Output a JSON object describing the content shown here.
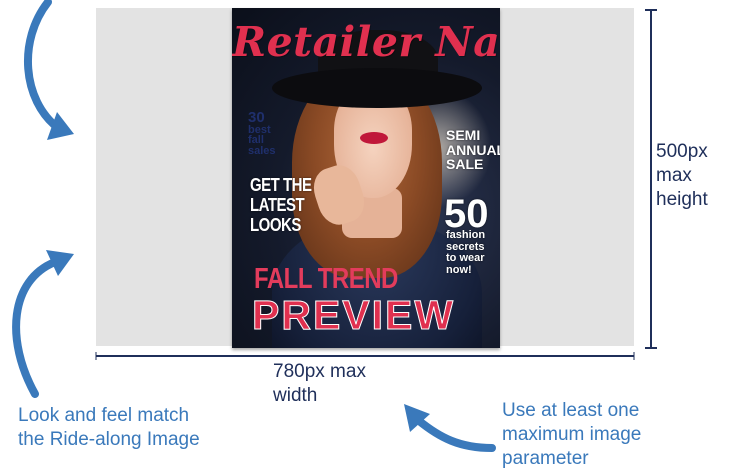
{
  "cover": {
    "masthead": "Retailer Name",
    "blurb_30_number": "30",
    "blurb_30_lines": [
      "best",
      "fall",
      "sales"
    ],
    "latest_lines": [
      "GET THE",
      "LATEST",
      "LOOKS"
    ],
    "semi_lines": [
      "SEMI",
      "ANNUAL",
      "SALE"
    ],
    "fifty_number": "50",
    "fifty_lines": [
      "fashion",
      "secrets",
      "to wear",
      "now!"
    ],
    "fall_trend": "FALL TREND",
    "preview": "PREVIEW"
  },
  "dimensions": {
    "height_lines": [
      "500px",
      "max",
      "height"
    ],
    "width_lines": [
      "780px max",
      "width"
    ]
  },
  "captions": {
    "left_lines": [
      "Look and feel match",
      "the Ride-along Image"
    ],
    "right_lines": [
      "Use at least one",
      "maximum image",
      "parameter"
    ]
  },
  "colors": {
    "arrow_blue": "#3a79bb",
    "dimension_navy": "#1f2f5a",
    "canvas_gray": "#e3e3e3",
    "masthead_red": "#e0304f"
  }
}
